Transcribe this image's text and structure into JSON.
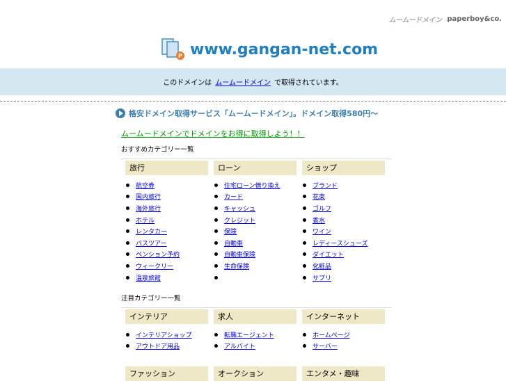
{
  "brand": {
    "muumuu": "ムームードメイン",
    "paperboy": "paperboy&co."
  },
  "domain": "www.gangan-net.com",
  "info_band": {
    "prefix": "このドメインは",
    "link": "ムームードメイン",
    "suffix": "で取得されています。"
  },
  "promo": "格安ドメイン取得サービス「ムームードメイン」。ドメイン取得580円～",
  "green_link": "ムームードメインでドメインをお得に取得しよう！！",
  "sections": [
    {
      "title": "おすすめカテゴリー一覧",
      "columns": [
        {
          "head": "旅行",
          "items": [
            "航空券",
            "国内旅行",
            "海外旅行",
            "ホテル",
            "レンタカー",
            "バスツアー",
            "ペンション予約",
            "ウィークリー",
            "温泉旅館"
          ]
        },
        {
          "head": "ローン",
          "items": [
            "住宅ローン借り換え",
            "カード",
            "キャッシュ",
            "クレジット",
            "保険",
            "自動車",
            "自動車保険",
            "生命保険"
          ]
        },
        {
          "head": "ショップ",
          "items": [
            "ブランド",
            "花束",
            "ゴルフ",
            "香水",
            "ワイン",
            "レディースシューズ",
            "ダイエット",
            "化粧品",
            "サプリ"
          ]
        }
      ]
    },
    {
      "title": "注目カテゴリー一覧",
      "columns": [
        {
          "head": "インテリア",
          "items": [
            "インテリアショップ",
            "アウトドア用品"
          ]
        },
        {
          "head": "求人",
          "items": [
            "転職エージェント",
            "アルバイト"
          ]
        },
        {
          "head": "インターネット",
          "items": [
            "ホームページ",
            "サーバー"
          ]
        }
      ]
    },
    {
      "columns": [
        {
          "head": "ファッション"
        },
        {
          "head": "オークション"
        },
        {
          "head": "エンタメ・趣味"
        }
      ]
    }
  ]
}
